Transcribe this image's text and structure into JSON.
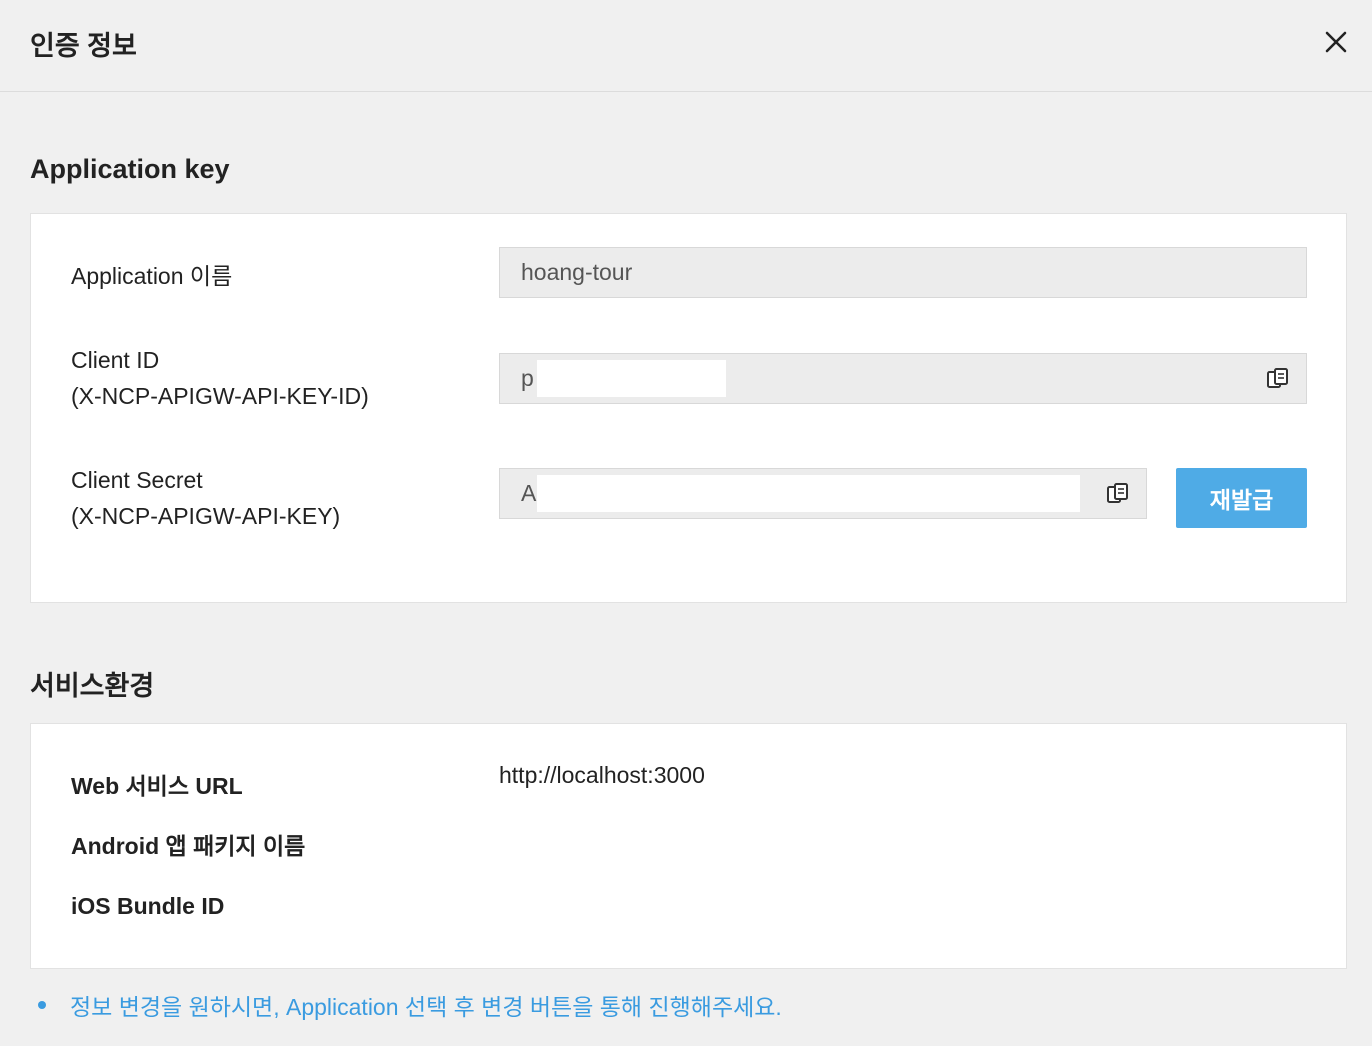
{
  "header": {
    "title": "인증 정보",
    "close_icon": "close-icon"
  },
  "application_key": {
    "section_title": "Application key",
    "app_name": {
      "label": "Application 이름",
      "value": "hoang-tour"
    },
    "client_id": {
      "label_line1": "Client ID",
      "label_line2": "(X-NCP-APIGW-API-KEY-ID)",
      "value_visible": "p",
      "copy_icon": "copy-icon"
    },
    "client_secret": {
      "label_line1": "Client Secret",
      "label_line2": "(X-NCP-APIGW-API-KEY)",
      "value_visible": "A",
      "copy_icon": "copy-icon"
    },
    "reissue_label": "재발급"
  },
  "service_env": {
    "section_title": "서비스환경",
    "web_url": {
      "label": "Web 서비스 URL",
      "value": "http://localhost:3000"
    },
    "android_package": {
      "label": "Android 앱 패키지 이름",
      "value": ""
    },
    "ios_bundle": {
      "label": "iOS Bundle ID",
      "value": ""
    }
  },
  "notice": "정보 변경을 원하시면, Application 선택 후 변경 버튼을 통해 진행해주세요.",
  "colors": {
    "accent": "#4fabe6",
    "notice_text": "#3a9be0",
    "background": "#f0f0f0",
    "field_bg": "#ececec"
  }
}
